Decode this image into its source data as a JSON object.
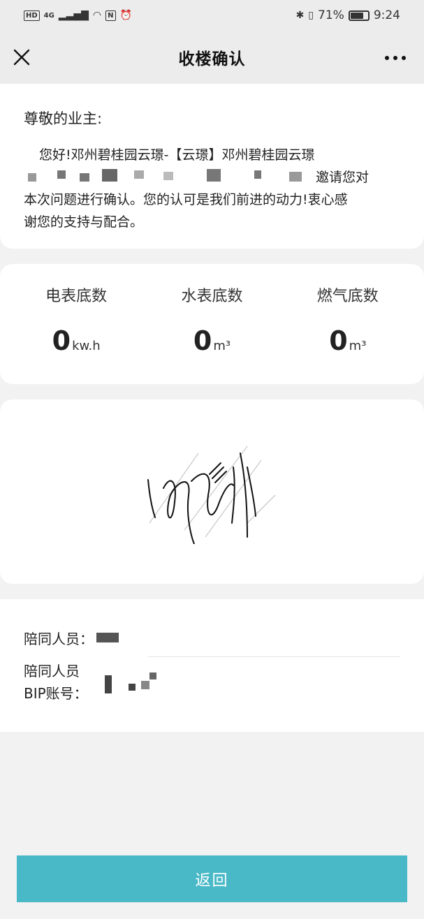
{
  "status_bar": {
    "hd": "HD",
    "network": "4G",
    "battery_percent": "71%",
    "battery_level": 0.71,
    "time": "9:24",
    "icons": [
      "signal-icon",
      "wifi-icon",
      "nfc-icon",
      "alarm-icon",
      "bluetooth-icon",
      "vibrate-icon",
      "battery-icon"
    ]
  },
  "nav": {
    "title": "收楼确认",
    "close_icon": "close-icon",
    "more_icon": "more-icon"
  },
  "greeting": {
    "salutation": "尊敬的业主:",
    "line1": "您好!邓州碧桂园云璟-【云璟】邓州碧桂园云璟",
    "line2_visible": "邀请您对",
    "line3_visible": "本次问题进行确认。您的认可是我们前进的动力!衷心感",
    "line4": "谢您的支持与配合。"
  },
  "meters": [
    {
      "label": "电表底数",
      "value": "0",
      "unit": "kw.h"
    },
    {
      "label": "水表底数",
      "value": "0",
      "unit": "m³"
    },
    {
      "label": "燃气底数",
      "value": "0",
      "unit": "m³"
    }
  ],
  "escort": {
    "name_label": "陪同人员：",
    "bip_label_line1": "陪同人员",
    "bip_label_line2": "BIP账号："
  },
  "footer": {
    "return_label": "返回"
  },
  "colors": {
    "accent": "#4ab9c7",
    "background": "#f2f2f2",
    "card": "#ffffff"
  }
}
